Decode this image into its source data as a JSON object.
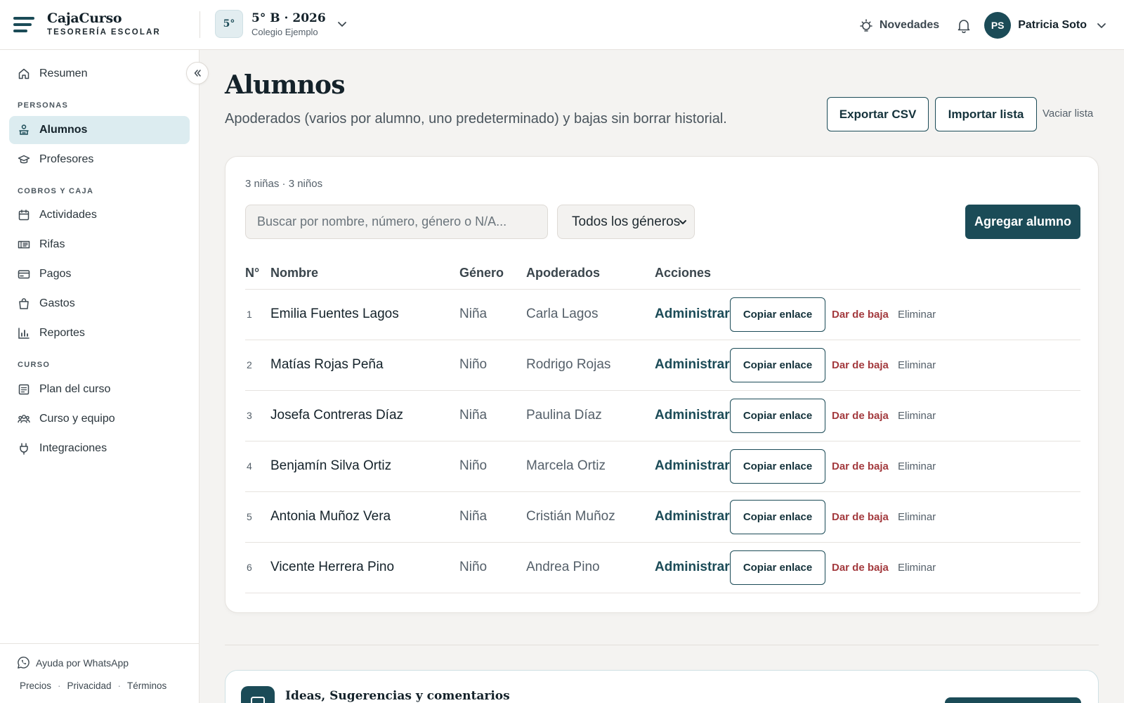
{
  "brand": {
    "name": "CajaCurso",
    "tagline": "TESORERÍA ESCOLAR"
  },
  "course": {
    "badge": "5°",
    "title": "5° B · 2026",
    "school": "Colegio Ejemplo"
  },
  "header": {
    "news_label": "Novedades",
    "user_initials": "PS",
    "user_name": "Patricia Soto"
  },
  "sidebar": {
    "summary": "Resumen",
    "sections": {
      "people": "PERSONAS",
      "billing": "COBROS Y CAJA",
      "course": "CURSO"
    },
    "items": {
      "students": "Alumnos",
      "teachers": "Profesores",
      "activities": "Actividades",
      "raffles": "Rifas",
      "payments": "Pagos",
      "expenses": "Gastos",
      "reports": "Reportes",
      "plan": "Plan del curso",
      "team": "Curso y equipo",
      "integrations": "Integraciones"
    },
    "active": "students",
    "whatsapp": "Ayuda por WhatsApp",
    "legal": {
      "pricing": "Precios",
      "privacy": "Privacidad",
      "terms": "Términos",
      "separator": "·"
    }
  },
  "main": {
    "title": "Alumnos",
    "subtitle": "Apoderados (varios por alumno, uno predeterminado) y bajas sin borrar historial.",
    "actions": {
      "export": "Exportar CSV",
      "import": "Importar lista",
      "clear": "Vaciar lista"
    }
  },
  "students": {
    "counts": "3 niñas · 3 niños",
    "search_placeholder": "Buscar por nombre, número, género o N/A...",
    "gender_filter": "Todos los géneros",
    "add_label": "Agregar alumno",
    "columns": {
      "num": "N°",
      "name": "Nombre",
      "gender": "Género",
      "guardians": "Apoderados",
      "actions": "Acciones"
    },
    "row_actions": {
      "manage": "Administrar",
      "copy": "Copiar enlace",
      "drop": "Dar de baja",
      "delete": "Eliminar"
    },
    "rows": [
      {
        "num": "1",
        "name": "Emilia Fuentes Lagos",
        "gender": "Niña",
        "guardian": "Carla Lagos"
      },
      {
        "num": "2",
        "name": "Matías Rojas Peña",
        "gender": "Niño",
        "guardian": "Rodrigo Rojas"
      },
      {
        "num": "3",
        "name": "Josefa Contreras Díaz",
        "gender": "Niña",
        "guardian": "Paulina Díaz"
      },
      {
        "num": "4",
        "name": "Benjamín Silva Ortiz",
        "gender": "Niño",
        "guardian": "Marcela Ortiz"
      },
      {
        "num": "5",
        "name": "Antonia Muñoz Vera",
        "gender": "Niña",
        "guardian": "Cristián Muñoz"
      },
      {
        "num": "6",
        "name": "Vicente Herrera Pino",
        "gender": "Niño",
        "guardian": "Andrea Pino"
      }
    ]
  },
  "feedback": {
    "title": "Ideas, Sugerencias y comentarios"
  },
  "colors": {
    "primary": "#1b4b57",
    "danger": "#a33a3e",
    "active_nav": "#dcecf0",
    "background": "#f4f3f1"
  },
  "icons": {
    "menu": "menu-icon",
    "chevron": "chevron-down-icon",
    "news": "sun-bulb-icon",
    "bell": "bell-icon",
    "collapse": "double-chevron-left-icon",
    "summary": "home-icon",
    "students": "student-icon",
    "teachers": "graduation-cap-icon",
    "activities": "calendar-icon",
    "raffles": "ticket-icon",
    "payments": "credit-card-icon",
    "expenses": "shopping-bag-icon",
    "reports": "bar-chart-icon",
    "plan": "document-icon",
    "team": "people-icon",
    "integrations": "plug-icon",
    "whatsapp": "whatsapp-icon",
    "feedback": "chat-icon"
  }
}
